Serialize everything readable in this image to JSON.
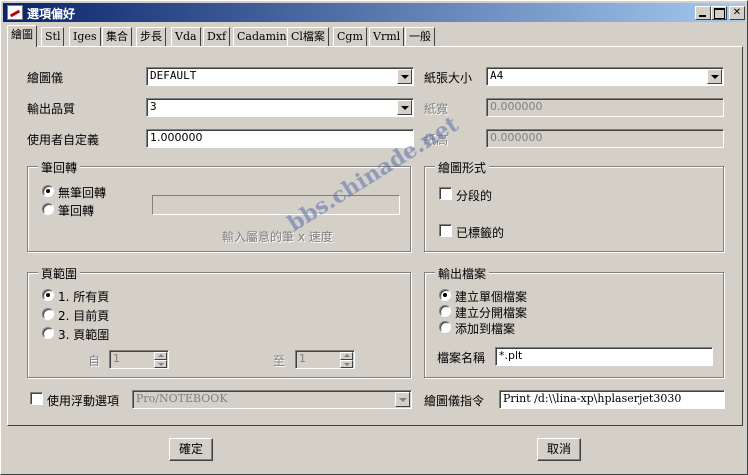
{
  "window": {
    "title": "選項偏好",
    "close_glyph": "✕"
  },
  "tabs": [
    "繪圖",
    "Stl",
    "Iges",
    "集合",
    "步長",
    "Vda",
    "Dxf",
    "Cadamin",
    "Cl檔案",
    "Cgm",
    "Vrml",
    "一般"
  ],
  "plot": {
    "plotter_label": "繪圖儀",
    "plotter_value": "DEFAULT",
    "quality_label": "輸出品質",
    "quality_value": "3",
    "user_scale_label": "使用者自定義",
    "user_scale_value": "1.000000"
  },
  "paper": {
    "size_label": "紙張大小",
    "size_value": "A4",
    "width_label": "紙寬",
    "width_value": "0.000000",
    "height_label": "紙高",
    "height_value": "0.000000"
  },
  "pen_group": {
    "title": "筆回轉",
    "options": [
      "無筆回轉",
      "筆回轉"
    ],
    "selected": 0,
    "hint": "輸入屬意的筆 x 速度"
  },
  "format_group": {
    "title": "繪圖形式",
    "options": [
      "分段的",
      "已標籤的"
    ]
  },
  "page_group": {
    "title": "頁範圍",
    "options": [
      "1. 所有頁",
      "2. 目前頁",
      "3. 頁範圍"
    ],
    "selected": 0,
    "from_label": "自",
    "from_value": "1",
    "to_label": "至",
    "to_value": "1"
  },
  "output_group": {
    "title": "輸出檔案",
    "options": [
      "建立單個檔案",
      "建立分開檔案",
      "添加到檔案"
    ],
    "selected": 0,
    "filename_label": "檔案名稱",
    "filename_value": "*.plt"
  },
  "floating": {
    "label": "使用浮動選項",
    "value": "Pro/NOTEBOOK"
  },
  "command": {
    "label": "繪圖儀指令",
    "value": "Print  /d:\\\\lina-xp\\hplaserjet3030"
  },
  "buttons": {
    "ok": "確定",
    "cancel": "取消"
  },
  "watermark": "bbs.chinade.net"
}
